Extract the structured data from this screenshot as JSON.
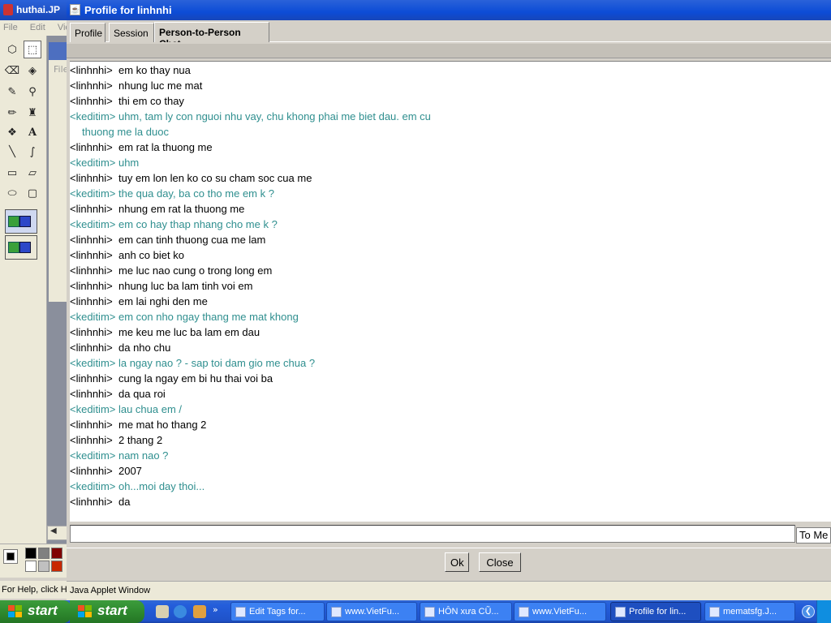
{
  "background_app": {
    "title": "huthai.JP",
    "menu": [
      "File",
      "Edit",
      "View"
    ],
    "inner_menu": "File",
    "status": "For Help, click He"
  },
  "window": {
    "title": "Profile for linhnhi",
    "tabs": [
      {
        "label": "Profile",
        "active": false
      },
      {
        "label": "Session",
        "active": false
      },
      {
        "label": "Person-to-Person Chat",
        "active": true
      }
    ]
  },
  "chat": {
    "messages": [
      {
        "speaker": "linhnhi",
        "text": "<linhnhi>  em ko thay nua"
      },
      {
        "speaker": "linhnhi",
        "text": "<linhnhi>  nhung luc me mat"
      },
      {
        "speaker": "linhnhi",
        "text": "<linhnhi>  thi em co thay"
      },
      {
        "speaker": "keditim",
        "text": "<keditim> uhm, tam ly con nguoi nhu vay, chu khong phai me biet dau. em cu"
      },
      {
        "speaker": "keditim",
        "text": "thuong me la duoc",
        "continuation": true
      },
      {
        "speaker": "linhnhi",
        "text": "<linhnhi>  em rat la thuong me"
      },
      {
        "speaker": "keditim",
        "text": "<keditim> uhm"
      },
      {
        "speaker": "linhnhi",
        "text": "<linhnhi>  tuy em lon len ko co su cham soc cua me"
      },
      {
        "speaker": "keditim",
        "text": "<keditim> the qua day, ba co tho me em k ?"
      },
      {
        "speaker": "linhnhi",
        "text": "<linhnhi>  nhung em rat la thuong me"
      },
      {
        "speaker": "keditim",
        "text": "<keditim> em co hay thap nhang cho me k ?"
      },
      {
        "speaker": "linhnhi",
        "text": "<linhnhi>  em can tinh thuong cua me lam"
      },
      {
        "speaker": "linhnhi",
        "text": "<linhnhi>  anh co biet ko"
      },
      {
        "speaker": "linhnhi",
        "text": "<linhnhi>  me luc nao cung o trong long em"
      },
      {
        "speaker": "linhnhi",
        "text": "<linhnhi>  nhung luc ba lam tinh voi em"
      },
      {
        "speaker": "linhnhi",
        "text": "<linhnhi>  em lai nghi den me"
      },
      {
        "speaker": "keditim",
        "text": "<keditim> em con nho ngay thang me mat khong"
      },
      {
        "speaker": "linhnhi",
        "text": "<linhnhi>  me keu me luc ba lam em dau"
      },
      {
        "speaker": "linhnhi",
        "text": "<linhnhi>  da nho chu"
      },
      {
        "speaker": "keditim",
        "text": "<keditim> la ngay nao ? - sap toi dam gio me chua ?"
      },
      {
        "speaker": "linhnhi",
        "text": "<linhnhi>  cung la ngay em bi hu thai voi ba"
      },
      {
        "speaker": "linhnhi",
        "text": "<linhnhi>  da qua roi"
      },
      {
        "speaker": "keditim",
        "text": "<keditim> lau chua em /"
      },
      {
        "speaker": "linhnhi",
        "text": "<linhnhi>  me mat ho thang 2"
      },
      {
        "speaker": "linhnhi",
        "text": "<linhnhi>  2 thang 2"
      },
      {
        "speaker": "keditim",
        "text": "<keditim> nam nao ?"
      },
      {
        "speaker": "linhnhi",
        "text": "<linhnhi>  2007"
      },
      {
        "speaker": "keditim",
        "text": "<keditim> oh...moi day thoi..."
      },
      {
        "speaker": "linhnhi",
        "text": "<linhnhi>  da"
      }
    ],
    "input_value": "",
    "recipient": "To Me"
  },
  "buttons": {
    "ok": "Ok",
    "close": "Close"
  },
  "applet_status": "Java Applet Window",
  "taskbar": {
    "start_labels": [
      "start",
      "start"
    ],
    "tasks": [
      {
        "label": "Edit Tags for...",
        "active": false
      },
      {
        "label": "www.VietFu...",
        "active": false
      },
      {
        "label": "HÔN xưa CŨ...",
        "active": false
      },
      {
        "label": "www.VietFu...",
        "active": false
      },
      {
        "label": "Profile for lin...",
        "active": true
      },
      {
        "label": "mematsfg.J...",
        "active": false
      }
    ]
  },
  "colors": {
    "keditim_text": "#2f8f8f",
    "linhnhi_text": "#000000",
    "title_bar": "#0c4cd6",
    "taskbar": "#245edb"
  }
}
